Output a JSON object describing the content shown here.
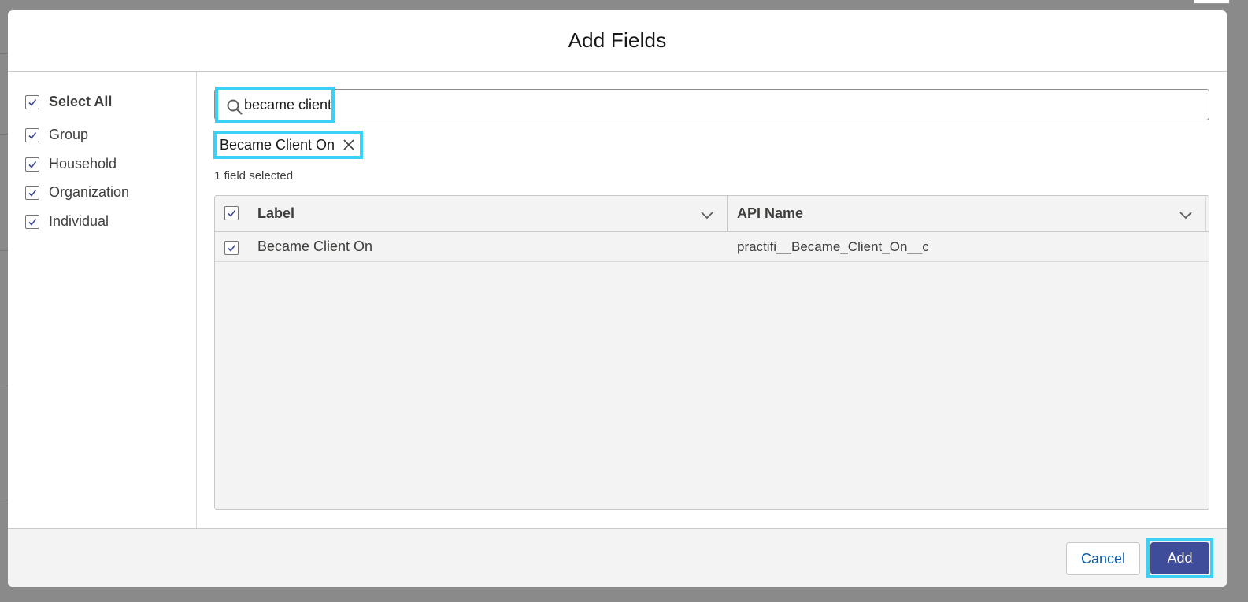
{
  "modal": {
    "title": "Add Fields"
  },
  "sidebar": {
    "items": [
      {
        "label": "Select All",
        "checked": true,
        "bold": true
      },
      {
        "label": "Group",
        "checked": true
      },
      {
        "label": "Household",
        "checked": true
      },
      {
        "label": "Organization",
        "checked": true
      },
      {
        "label": "Individual",
        "checked": true
      }
    ]
  },
  "search": {
    "value": "became client",
    "icon": "search-icon"
  },
  "selected_pill": {
    "label": "Became Client On",
    "icon": "close-icon"
  },
  "selection_count": "1 field selected",
  "table": {
    "columns": [
      {
        "label": "Label"
      },
      {
        "label": "API Name"
      }
    ],
    "rows": [
      {
        "checked": true,
        "label": "Became Client On",
        "api_name": "practifi__Became_Client_On__c"
      }
    ]
  },
  "footer": {
    "cancel_label": "Cancel",
    "add_label": "Add"
  },
  "colors": {
    "highlight": "#3bd1f6",
    "brand_button": "#3e4c9a",
    "link": "#0b5cab"
  }
}
